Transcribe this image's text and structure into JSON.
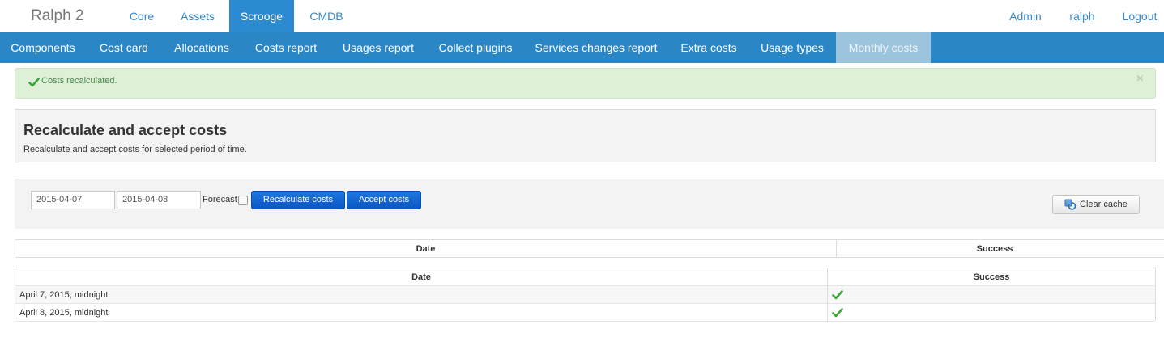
{
  "topbar": {
    "brand": "Ralph 2",
    "items": [
      {
        "label": "Core"
      },
      {
        "label": "Assets"
      },
      {
        "label": "Scrooge"
      },
      {
        "label": "CMDB"
      }
    ],
    "right": [
      {
        "label": "Admin"
      },
      {
        "label": "ralph"
      },
      {
        "label": "Logout"
      }
    ]
  },
  "subnav": {
    "items": [
      {
        "label": "Components"
      },
      {
        "label": "Cost card"
      },
      {
        "label": "Allocations"
      },
      {
        "label": "Costs report"
      },
      {
        "label": "Usages report"
      },
      {
        "label": "Collect plugins"
      },
      {
        "label": "Services changes report"
      },
      {
        "label": "Extra costs"
      },
      {
        "label": "Usage types"
      },
      {
        "label": "Monthly costs"
      }
    ],
    "active": "Monthly costs"
  },
  "alert": {
    "icon": "check-icon",
    "message": "Costs recalculated.",
    "close": "×",
    "colors": {
      "bg": "#dff0d8",
      "text": "#468847"
    }
  },
  "hero": {
    "title": "Recalculate and accept costs",
    "subtitle": "Recalculate and accept costs for selected period of time."
  },
  "form": {
    "start_date": "2015-04-07",
    "end_date": "2015-04-08",
    "forecast_label": "Forecast",
    "forecast_checked": false,
    "recalculate_label": "Recalculate costs",
    "accept_label": "Accept costs",
    "clear_cache_label": "Clear cache"
  },
  "table_header": {
    "columns": [
      "Date",
      "Success"
    ]
  },
  "table": {
    "columns": [
      "Date",
      "Success"
    ],
    "rows": [
      {
        "date": "April 7, 2015, midnight",
        "success": true
      },
      {
        "date": "April 8, 2015, midnight",
        "success": true
      }
    ]
  },
  "colors": {
    "accent": "#2b86c6",
    "primary_button": "#0b56c5",
    "success_check": "#3aa53a"
  }
}
